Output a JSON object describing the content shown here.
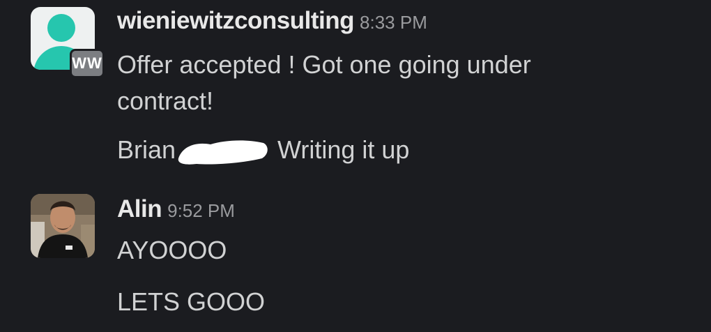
{
  "messages": [
    {
      "sender": "wieniewitzconsulting",
      "time": "8:33 PM",
      "org_badge": "WW",
      "avatar_icon": "user-placeholder-icon",
      "lines": [
        "Offer accepted !   Got one going under",
        "contract!"
      ],
      "followup": {
        "before": "Brian",
        "after": " Writing it up"
      }
    },
    {
      "sender": "Alin",
      "time": "9:52 PM",
      "avatar_icon": "user-photo",
      "lines": [
        "AYOOOO",
        "LETS GOOO"
      ]
    }
  ],
  "colors": {
    "background": "#1b1c20",
    "text": "#d1d2d3",
    "sender": "#e8e8e8",
    "timestamp": "#9a9b9e",
    "avatar_accent": "#26c6ae",
    "redaction": "#ffffff"
  }
}
